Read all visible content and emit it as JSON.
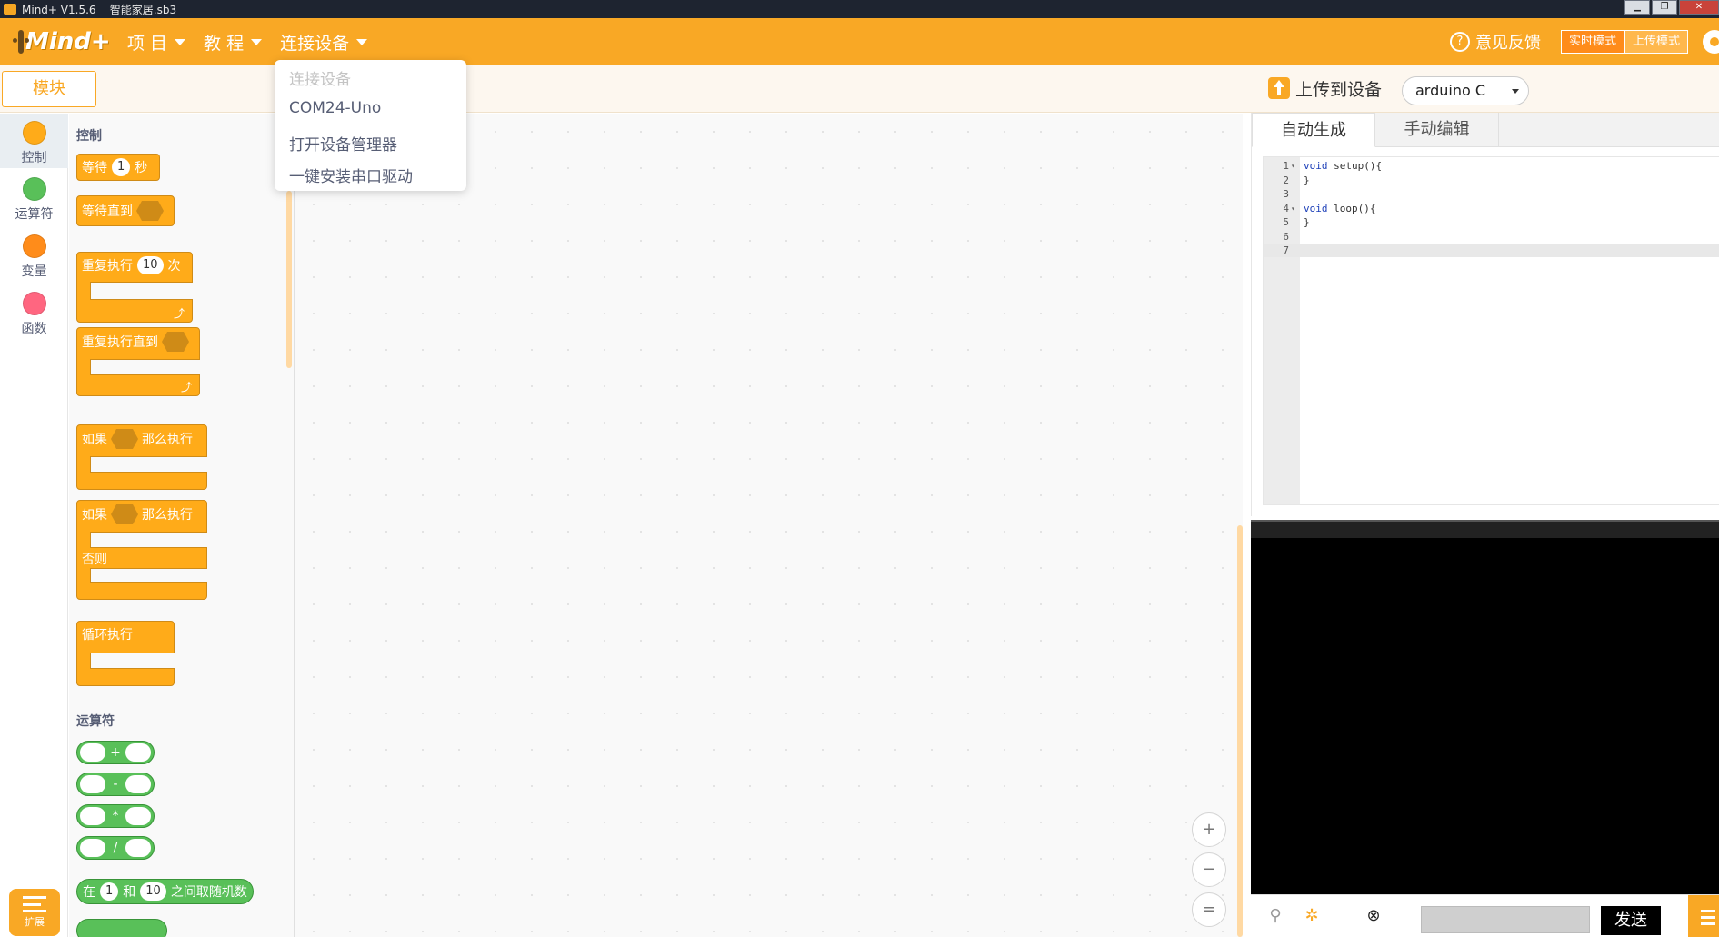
{
  "window": {
    "title": "Mind+ V1.5.6    智能家居.sb3"
  },
  "menubar": {
    "logo_text": "Mind+",
    "items": [
      {
        "label": "项 目"
      },
      {
        "label": "教 程"
      },
      {
        "label": "连接设备"
      }
    ],
    "feedback_label": "意见反馈",
    "mode_realtime": "实时模式",
    "mode_upload": "上传模式"
  },
  "toolbar": {
    "module_tab": "模块",
    "upload_label": "上传到设备",
    "language_selected": "arduino C"
  },
  "dropdown": {
    "items": [
      {
        "label": "连接设备",
        "disabled": true
      },
      {
        "label": "COM24-Uno"
      },
      {
        "label": "打开设备管理器"
      },
      {
        "label": "一键安装串口驱动"
      }
    ]
  },
  "categories": [
    {
      "label": "控制",
      "color": "#ffab19"
    },
    {
      "label": "运算符",
      "color": "#59c059"
    },
    {
      "label": "变量",
      "color": "#ff8c1a"
    },
    {
      "label": "函数",
      "color": "#ff6680"
    }
  ],
  "extension_label": "扩展",
  "palette": {
    "control_title": "控制",
    "wait": {
      "pre": "等待",
      "value": "1",
      "post": "秒"
    },
    "wait_until": "等待直到",
    "repeat": {
      "pre": "重复执行",
      "value": "10",
      "post": "次"
    },
    "repeat_until": "重复执行直到",
    "if_then": {
      "pre": "如果",
      "post": "那么执行"
    },
    "if_else": {
      "pre": "如果",
      "post": "那么执行",
      "else": "否则"
    },
    "forever": "循环执行",
    "operators_title": "运算符",
    "ops": [
      "+",
      "-",
      "*",
      "/"
    ],
    "random": {
      "pre": "在",
      "a": "1",
      "mid": "和",
      "b": "10",
      "post": "之间取随机数"
    }
  },
  "code": {
    "tab_auto": "自动生成",
    "tab_manual": "手动编辑",
    "lines": [
      {
        "n": "1",
        "kw": "void",
        "rest": " setup(){",
        "fold": true
      },
      {
        "n": "2",
        "kw": "",
        "rest": "}",
        "fold": false
      },
      {
        "n": "3",
        "kw": "",
        "rest": "",
        "fold": false
      },
      {
        "n": "4",
        "kw": "void",
        "rest": " loop(){",
        "fold": true
      },
      {
        "n": "5",
        "kw": "",
        "rest": "}",
        "fold": false
      },
      {
        "n": "6",
        "kw": "",
        "rest": "",
        "fold": false
      },
      {
        "n": "7",
        "kw": "",
        "rest": "",
        "fold": false
      }
    ]
  },
  "zoom": {
    "in": "+",
    "out": "−",
    "reset": "="
  },
  "serial": {
    "send_label": "发送"
  }
}
